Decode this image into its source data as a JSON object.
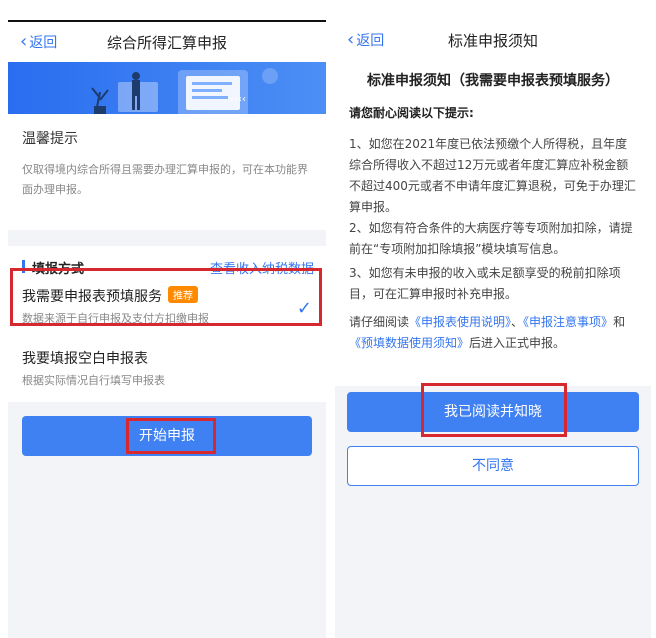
{
  "left": {
    "back_label": "返回",
    "title": "综合所得汇算申报",
    "tips": {
      "heading": "温馨提示",
      "text": "仅取得境内综合所得且需要办理汇算申报的，可在本功能界面办理申报。"
    },
    "fill_method": {
      "label": "填报方式",
      "link": "查看收入纳税数据",
      "options": [
        {
          "title": "我需要申报表预填服务",
          "badge": "推荐",
          "subtitle": "数据来源于自行申报及支付方扣缴申报",
          "selected": true
        },
        {
          "title": "我要填报空白申报表",
          "subtitle": "根据实际情况自行填写申报表",
          "selected": false
        }
      ]
    },
    "start_button": "开始申报"
  },
  "right": {
    "back_label": "返回",
    "title": "标准申报须知",
    "notice": {
      "title": "标准申报须知（我需要申报表预填服务）",
      "intro": "请您耐心阅读以下提示:",
      "items": [
        "1、如您在2021年度已依法预缴个人所得税，且年度综合所得收入不超过12万元或者年度汇算应补税金额不超过400元或者不申请年度汇算退税，可免于办理汇算申报。",
        "2、如您有符合条件的大病医疗等专项附加扣除，请提前在“专项附加扣除填报”模块填写信息。",
        "3、如您有未申报的收入或未足额享受的税前扣除项目，可在汇算申报时补充申报。"
      ],
      "read_prefix": "请仔细阅读",
      "read_link1": "《申报表使用说明》",
      "read_sep1": "、",
      "read_link2": "《申报注意事项》",
      "read_and": "和",
      "read_link3": "《预填数据使用须知》",
      "read_suffix": "后进入正式申报。"
    },
    "agree_button": "我已阅读并知晓",
    "disagree_button": "不同意"
  },
  "colors": {
    "accent": "#3476f0",
    "highlight_box": "#d6282e",
    "badge": "#ff8a00"
  }
}
